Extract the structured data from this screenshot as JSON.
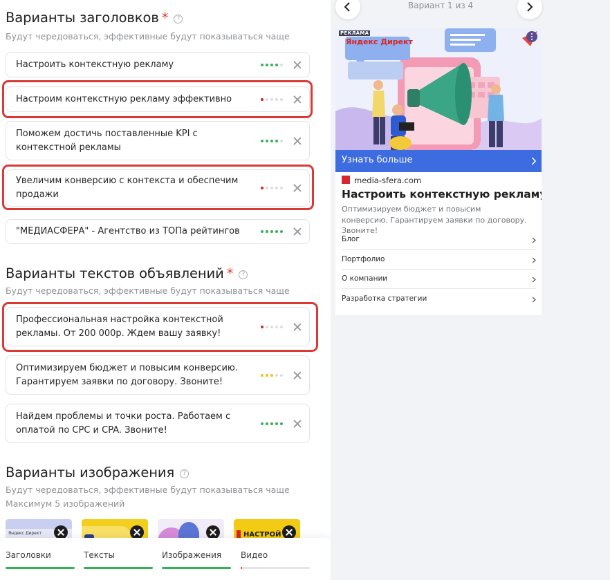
{
  "headlines_section": {
    "title": "Варианты заголовков",
    "required_mark": "*",
    "help_icon": "?",
    "subtitle": "Будут чередоваться, эффективные будут показываться чаще",
    "items": [
      {
        "text": "Настроить контекстную рекламу",
        "score": 4,
        "score_color": "#34b356",
        "highlighted": false
      },
      {
        "text": "Настроим контекстную рекламу эффективно",
        "score": 1,
        "score_color": "#c8262b",
        "highlighted": true
      },
      {
        "text": "Поможем достичь поставленные KPI с контекстной рекламы",
        "score": 4,
        "score_color": "#34b356",
        "highlighted": false
      },
      {
        "text": "Увеличим конверсию с контекста и обеспечим продажи",
        "score": 1,
        "score_color": "#c8262b",
        "highlighted": true
      },
      {
        "text": "\"МЕДИАСФЕРА\" - Агентство из ТОПа рейтингов",
        "score": 5,
        "score_color": "#34b356",
        "highlighted": false
      }
    ]
  },
  "texts_section": {
    "title": "Варианты текстов объявлений",
    "required_mark": "*",
    "help_icon": "?",
    "subtitle": "Будут чередоваться, эффективные будут показываться чаще",
    "items": [
      {
        "text": "Профессиональная настройка контекстной рекламы. От 200 000р. Ждем вашу заявку!",
        "score": 1,
        "score_color": "#c8262b",
        "highlighted": true
      },
      {
        "text": "Оптимизируем бюджет и повысим конверсию. Гарантируем заявки по договору. Звоните!",
        "score": 3,
        "score_color": "#f2c21b",
        "highlighted": false
      },
      {
        "text": "Найдем проблемы и точки роста. Работаем с оплатой по CPC и CPA. Звоните!",
        "score": 5,
        "score_color": "#34b356",
        "highlighted": false
      }
    ]
  },
  "images_section": {
    "title": "Варианты изображения",
    "help_icon": "?",
    "subtitle": "Будут чередоваться, эффективные будут показываться чаще",
    "limit_note": "Максимум 5 изображений",
    "thumbnails": [
      {
        "label": "Яндекс Директ"
      },
      {
        "label": ""
      },
      {
        "label": ""
      },
      {
        "label": "НАСТРОЙ"
      }
    ]
  },
  "bottom_tabs": [
    {
      "label": "Заголовки",
      "progress": 1.0,
      "color": "#34b356"
    },
    {
      "label": "Тексты",
      "progress": 1.0,
      "color": "#34b356"
    },
    {
      "label": "Изображения",
      "progress": 1.0,
      "color": "#34b356"
    },
    {
      "label": "Видео",
      "progress": 0.02,
      "color": "#e1352a"
    }
  ],
  "preview": {
    "variant_label": "Вариант 1 из 4",
    "ad_badge": "РЕКЛАМА",
    "brand_text": "Яндекс Директ",
    "cta_label": "Узнать больше",
    "domain": "media-sfera.com",
    "title": "Настроить контекстную рекламу",
    "text": "Оптимизируем бюджет и повысим конверсию. Гарантируем заявки по договору. Звоните!",
    "sitelinks": [
      "Блог",
      "Портфолио",
      "О компании",
      "Разработка стратегии"
    ]
  }
}
